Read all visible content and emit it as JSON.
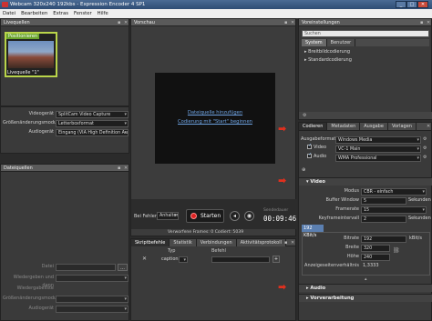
{
  "window": {
    "title": "Webcam 320x240 192kbs - Expression Encoder 4 SP1",
    "min": "_",
    "max": "□",
    "close": "✕"
  },
  "menu": [
    "Datei",
    "Bearbeiten",
    "Extras",
    "Fenster",
    "Hilfe"
  ],
  "live_sources": {
    "header": "Livequellen",
    "badge": "Positionieren",
    "caption": "Livequelle \"1\""
  },
  "source_settings": {
    "rows": [
      {
        "label": "Videogerät",
        "value": "SplitCam Video Capture"
      },
      {
        "label": "Größenänderungsmodus",
        "value": "Letterboxformat"
      },
      {
        "label": "Audiogerät",
        "value": "Eingang (VIA High Definition Aud"
      }
    ]
  },
  "file_sources": {
    "header": "Dateiquellen",
    "rows": [
      {
        "label": "Datei"
      },
      {
        "label": "Wiedergeben und dann"
      },
      {
        "label": "Wiedergabeliste"
      },
      {
        "label": "Größenänderungsmodus"
      },
      {
        "label": "Audiogerät"
      }
    ]
  },
  "preview": {
    "header": "Vorschau",
    "link1": "Dateiquelle hinzufügen",
    "link2": "Codierung mit \"Start\" beginnen",
    "dropped_label": "Verworfene Frames: 0 Codiert: 5039"
  },
  "controls": {
    "on_error_label": "Bei Fehler",
    "on_error_value": "Anhalten",
    "start_label": "Starten",
    "time_label": "Sendedauer",
    "time_value": "00:09:46"
  },
  "script_panel": {
    "tabs": [
      "Skriptbefehle",
      "Statistik",
      "Verbindungen",
      "Aktivitätsprotokoll"
    ],
    "col_type": "Typ",
    "col_cmd": "Befehl",
    "row_type": "caption"
  },
  "presets": {
    "header": "Voreinstellungen",
    "search_placeholder": "Suchen",
    "tabs": [
      "System",
      "Benutzer"
    ],
    "items": [
      "Breitbildcodierung",
      "Standardcodierung"
    ]
  },
  "encode": {
    "tabs": [
      "Codieren",
      "Metadaten",
      "Ausgabe",
      "Vorlagen"
    ],
    "output_format_label": "Ausgabeformat",
    "output_format_value": "Windows Media",
    "video_label": "Video",
    "video_value": "VC-1 Main",
    "audio_label": "Audio",
    "audio_value": "WMA Professional",
    "video_section": "Video",
    "mode_label": "Modus",
    "mode_value": "CBR - einfach",
    "buffer_label": "Buffer Window",
    "buffer_value": "5",
    "buffer_unit": "Sekunden",
    "framerate_label": "Framerate",
    "framerate_value": "15",
    "keyframe_label": "Keyframeintervall",
    "keyframe_value": "2",
    "keyframe_unit": "Sekunden",
    "stream_tag": "192 KBit/s",
    "bitrate_label": "Bitrate",
    "bitrate_value": "192",
    "bitrate_unit": "kBit/s",
    "width_label": "Breite",
    "width_value": "320",
    "height_label": "Höhe",
    "height_value": "240",
    "ratio_label": "Anzeigeseitenverhältnis",
    "ratio_value": "1,3333",
    "audio_section": "Audio",
    "preprocess_section": "Vorverarbeitung"
  }
}
